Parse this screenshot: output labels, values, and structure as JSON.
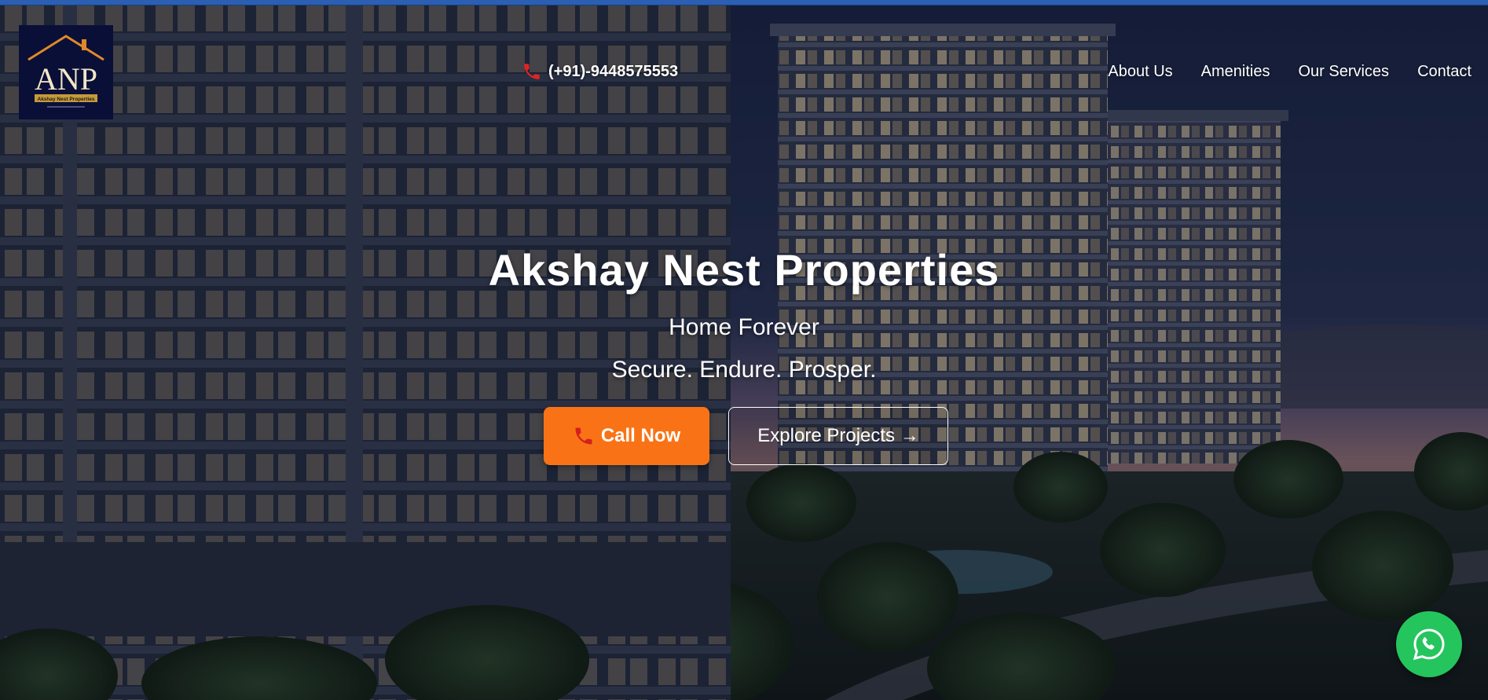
{
  "brand": {
    "logo_initials": "ANP",
    "logo_name": "Akshay Nest Properties"
  },
  "header": {
    "phone_label": "(+91)-9448575553",
    "nav": [
      {
        "label": "About Us"
      },
      {
        "label": "Amenities"
      },
      {
        "label": "Our Services"
      },
      {
        "label": "Contact"
      }
    ]
  },
  "hero": {
    "title": "Akshay Nest Properties",
    "subtitle": "Home Forever",
    "tagline": "Secure. Endure. Prosper.",
    "call_button_label": "Call Now",
    "explore_button_label": "Explore Projects →"
  },
  "icons": {
    "phone": "phone-icon",
    "whatsapp": "whatsapp-icon"
  },
  "colors": {
    "accent": "#f97316",
    "whatsapp": "#25c55d",
    "logo_bg": "#0a0f38",
    "logo_gold": "#e0892a"
  }
}
